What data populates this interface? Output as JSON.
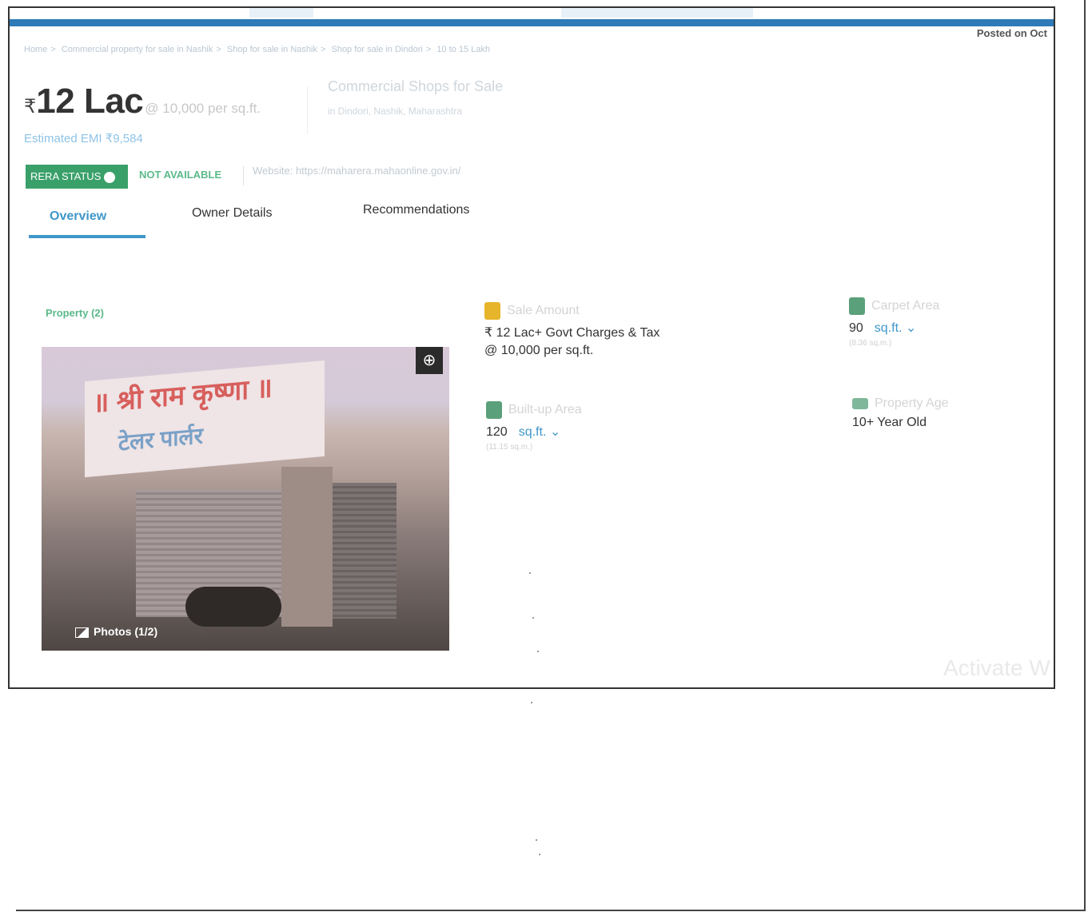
{
  "header": {
    "posted_on": "Posted on Oct",
    "breadcrumb": [
      "Home",
      "Commercial property for sale in Nashik",
      "Shop for sale in Nashik",
      "Shop for sale in Dindori",
      "10 to 15 Lakh"
    ]
  },
  "price": {
    "currency_symbol": "₹",
    "amount": "12 Lac",
    "rate": "@ 10,000 per sq.ft.",
    "emi": "Estimated EMI ₹9,584"
  },
  "property": {
    "title": "Commercial Shops for Sale",
    "location": "in Dindori, Nashik, Maharashtra"
  },
  "rera": {
    "badge_label": "RERA STATUS",
    "status": "NOT AVAILABLE",
    "website": "Website: https://maharera.mahaonline.gov.in/"
  },
  "tabs": [
    {
      "label": "Overview",
      "active": true
    },
    {
      "label": "Owner Details",
      "active": false
    },
    {
      "label": "Recommendations",
      "active": false
    }
  ],
  "gallery": {
    "section_label": "Property (2)",
    "photos_label": "Photos (1/2)",
    "sign_text": "॥ श्री राम कृष्णा ॥",
    "sign_sub": "टेलर पार्लर"
  },
  "details": {
    "sale_amount": {
      "label": "Sale Amount",
      "value": "₹ 12 Lac+ Govt Charges & Tax",
      "value2": "@ 10,000 per sq.ft.",
      "icon": "money-bag-icon"
    },
    "carpet_area": {
      "label": "Carpet Area",
      "value": "90",
      "unit": "sq.ft. ⌄",
      "sub": "(8.36 sq.m.)",
      "icon": "area-icon"
    },
    "built_up_area": {
      "label": "Built-up Area",
      "value": "120",
      "unit": "sq.ft. ⌄",
      "sub": "(11.15 sq.m.)",
      "icon": "area-icon"
    },
    "property_age": {
      "label": "Property Age",
      "value": "10+ Year Old",
      "icon": "cake-icon"
    }
  },
  "watermark": "Activate W",
  "colors": {
    "brand_blue": "#2e7bb8",
    "tab_active": "#3f97c9",
    "rera_green": "#3aa06a"
  }
}
